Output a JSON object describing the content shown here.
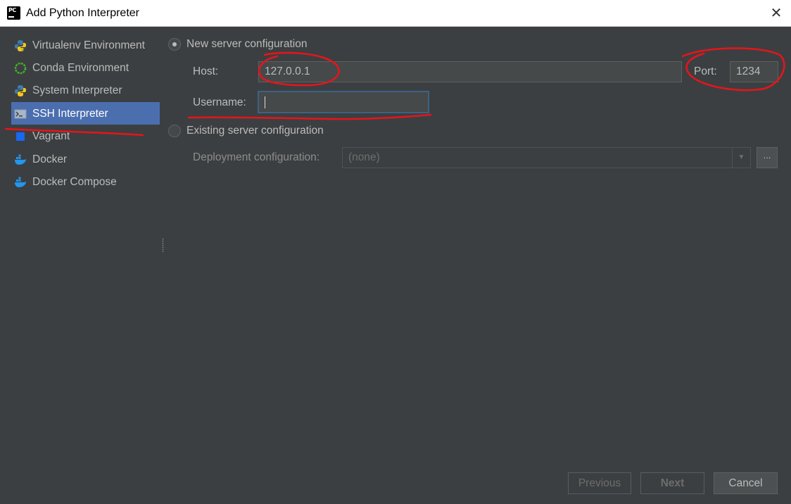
{
  "window": {
    "title": "Add Python Interpreter",
    "close_glyph": "✕"
  },
  "sidebar": {
    "items": [
      {
        "label": "Virtualenv Environment",
        "icon": "python-icon"
      },
      {
        "label": "Conda Environment",
        "icon": "conda-icon"
      },
      {
        "label": "System Interpreter",
        "icon": "python-icon"
      },
      {
        "label": "SSH Interpreter",
        "icon": "terminal-icon",
        "selected": true
      },
      {
        "label": "Vagrant",
        "icon": "vagrant-icon"
      },
      {
        "label": "Docker",
        "icon": "docker-icon"
      },
      {
        "label": "Docker Compose",
        "icon": "docker-icon"
      }
    ]
  },
  "form": {
    "new_server_label": "New server configuration",
    "host_label": "Host:",
    "host_value": "127.0.0.1",
    "port_label": "Port:",
    "port_value": "1234",
    "username_label": "Username:",
    "username_value": "",
    "existing_server_label": "Existing server configuration",
    "deployment_label": "Deployment configuration:",
    "deployment_value": "(none)",
    "browse_label": "..."
  },
  "buttons": {
    "previous": "Previous",
    "next": "Next",
    "cancel": "Cancel"
  },
  "colors": {
    "background": "#3c3f41",
    "selection": "#4b6eaf",
    "annotation": "#e8141b"
  }
}
